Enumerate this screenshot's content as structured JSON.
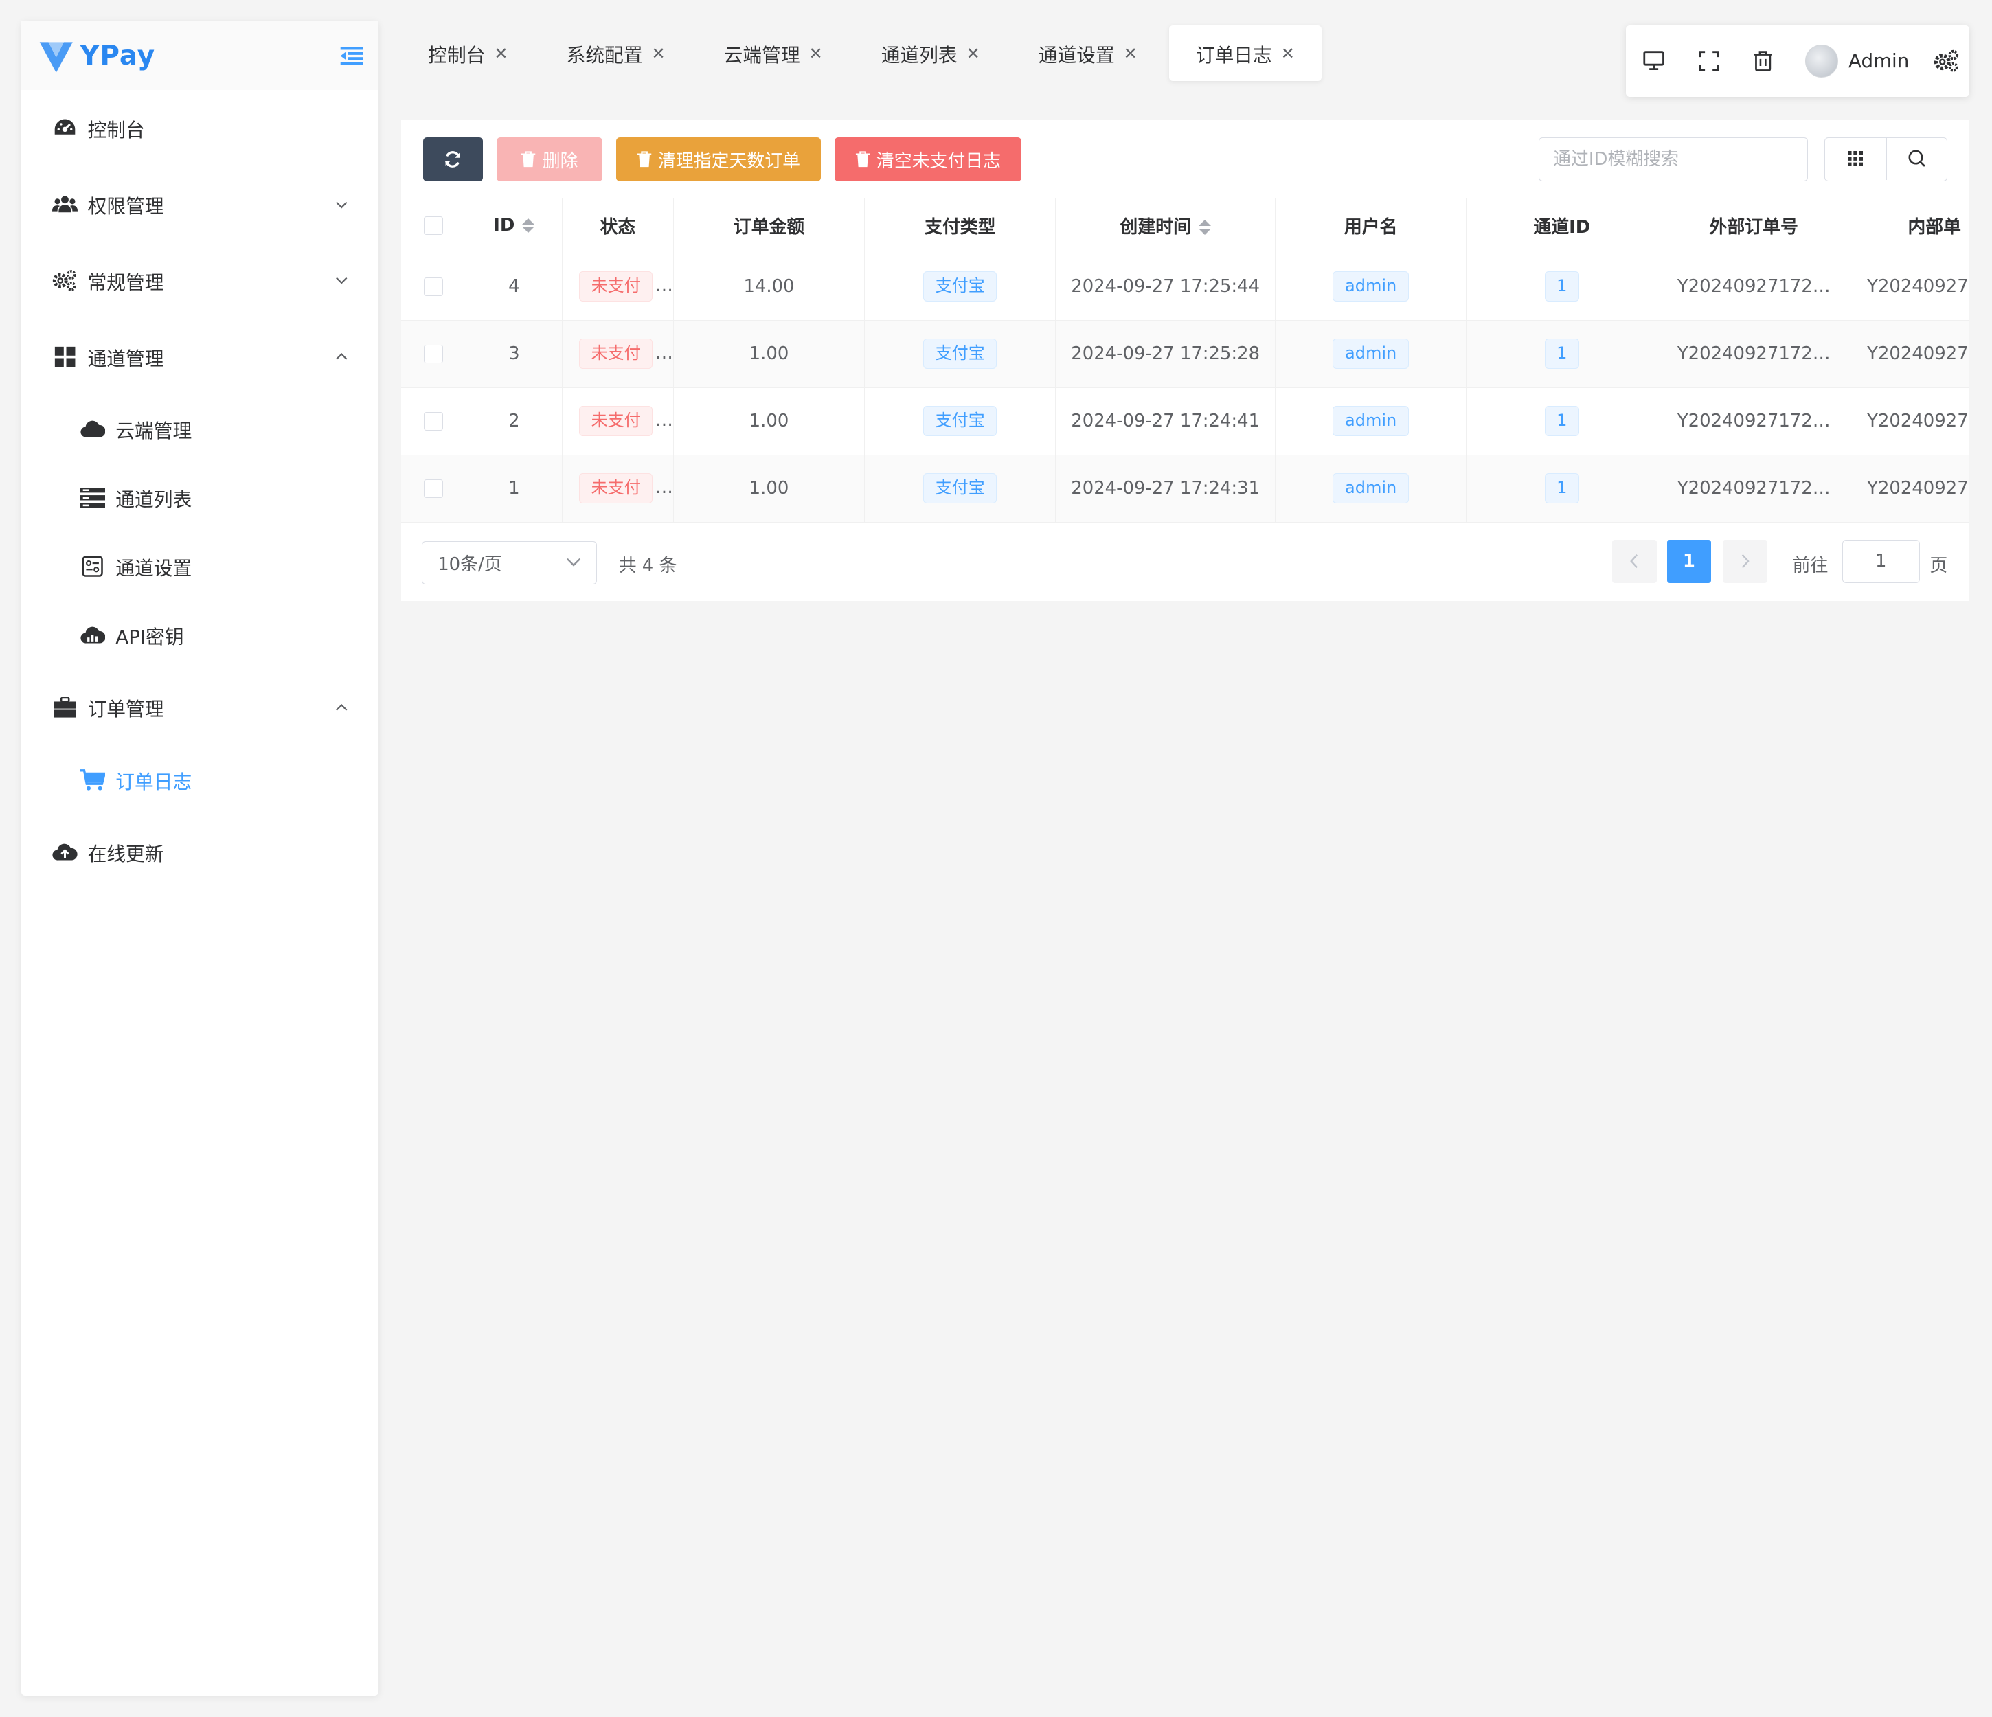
{
  "brand": {
    "name": "YPay",
    "color": "#2a87f0"
  },
  "sidebar": {
    "items": [
      {
        "label": "控制台",
        "icon": "dashboard-icon"
      },
      {
        "label": "权限管理",
        "icon": "users-icon",
        "expanded": false
      },
      {
        "label": "常规管理",
        "icon": "cogs-icon",
        "expanded": false
      },
      {
        "label": "通道管理",
        "icon": "grid-icon",
        "expanded": true,
        "children": [
          {
            "label": "云端管理",
            "icon": "cloud-icon"
          },
          {
            "label": "通道列表",
            "icon": "server-icon"
          },
          {
            "label": "通道设置",
            "icon": "settings-panel-icon"
          },
          {
            "label": "API密钥",
            "icon": "cloud-chart-icon"
          }
        ]
      },
      {
        "label": "订单管理",
        "icon": "briefcase-icon",
        "expanded": true,
        "children": [
          {
            "label": "订单日志",
            "icon": "cart-icon",
            "active": true
          }
        ]
      },
      {
        "label": "在线更新",
        "icon": "cloud-upload-icon"
      }
    ]
  },
  "tabs": [
    {
      "label": "控制台"
    },
    {
      "label": "系统配置"
    },
    {
      "label": "云端管理"
    },
    {
      "label": "通道列表"
    },
    {
      "label": "通道设置"
    },
    {
      "label": "订单日志",
      "active": true
    }
  ],
  "topbar": {
    "icons": [
      "monitor-icon",
      "fullscreen-icon",
      "trash-icon"
    ],
    "user": "Admin",
    "settings_icon": "gears-icon"
  },
  "toolbar": {
    "refresh_icon": "refresh-icon",
    "delete_label": "删除",
    "clean_label": "清理指定天数订单",
    "clear_label": "清空未支付日志",
    "search_placeholder": "通过ID模糊搜索"
  },
  "table": {
    "columns": [
      "ID",
      "状态",
      "订单金额",
      "支付类型",
      "创建时间",
      "用户名",
      "通道ID",
      "外部订单号",
      "内部单"
    ],
    "rows": [
      {
        "id": "4",
        "status": "未支付",
        "amount": "14.00",
        "pay_type": "支付宝",
        "created": "2024-09-27 17:25:44",
        "user": "admin",
        "channel": "1",
        "out_no": "Y20240927172…",
        "in_no": "Y20240927"
      },
      {
        "id": "3",
        "status": "未支付",
        "amount": "1.00",
        "pay_type": "支付宝",
        "created": "2024-09-27 17:25:28",
        "user": "admin",
        "channel": "1",
        "out_no": "Y20240927172…",
        "in_no": "Y20240927"
      },
      {
        "id": "2",
        "status": "未支付",
        "amount": "1.00",
        "pay_type": "支付宝",
        "created": "2024-09-27 17:24:41",
        "user": "admin",
        "channel": "1",
        "out_no": "Y20240927172…",
        "in_no": "Y20240927"
      },
      {
        "id": "1",
        "status": "未支付",
        "amount": "1.00",
        "pay_type": "支付宝",
        "created": "2024-09-27 17:24:31",
        "user": "admin",
        "channel": "1",
        "out_no": "Y20240927172…",
        "in_no": "Y20240927"
      }
    ]
  },
  "pagination": {
    "page_size": "10条/页",
    "total": "共 4 条",
    "current_page": "1",
    "goto_prefix": "前往",
    "goto_value": "1",
    "goto_suffix": "页"
  },
  "colors": {
    "primary": "#409eff",
    "danger": "#f56c6c",
    "warning": "#e9a23b",
    "dark": "#3d4a5c"
  }
}
